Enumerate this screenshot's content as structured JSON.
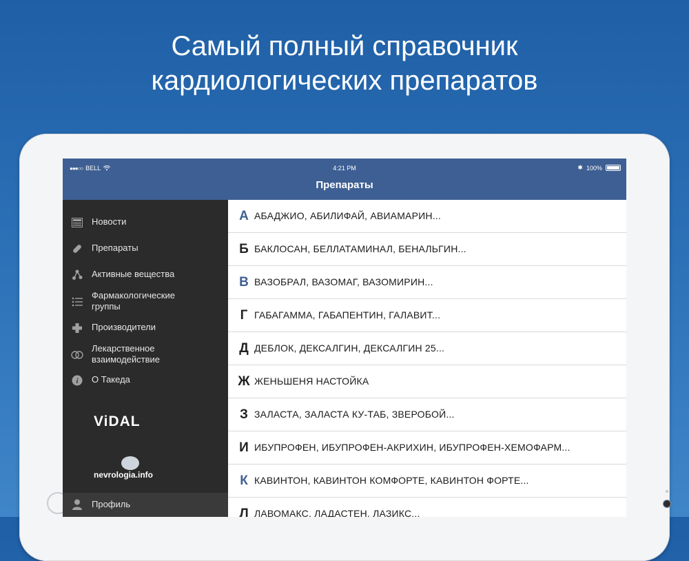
{
  "headline": {
    "line1": "Самый полный справочник",
    "line2": "кардиологических препаратов"
  },
  "status_bar": {
    "carrier": "BELL",
    "signal_dots": "●●●○○",
    "time": "4:21 PM",
    "battery": "100%"
  },
  "nav": {
    "title": "Препараты"
  },
  "sidebar": {
    "items": [
      {
        "label": "Новости",
        "icon": "news-icon"
      },
      {
        "label": "Препараты",
        "icon": "pill-icon"
      },
      {
        "label": "Активные вещества",
        "icon": "molecule-icon"
      },
      {
        "label": "Фармакологические группы",
        "icon": "list-icon"
      },
      {
        "label": "Производители",
        "icon": "plus-icon"
      },
      {
        "label": "Лекарственное взаимодействие",
        "icon": "interaction-icon"
      },
      {
        "label": "О Такеда",
        "icon": "info-icon"
      }
    ],
    "vidal_logo": "ViDAL",
    "nevrologia_logo": "nevrologia.info",
    "profile_label": "Профиль"
  },
  "alphabet_list": [
    {
      "letter": "А",
      "text": "АБАДЖИО, АБИЛИФАЙ, АВИАМАРИН..."
    },
    {
      "letter": "Б",
      "text": "БАКЛОСАН, БЕЛЛАТАМИНАЛ, БЕНАЛЬГИН..."
    },
    {
      "letter": "В",
      "text": "ВАЗОБРАЛ, ВАЗОМАГ, ВАЗОМИРИН..."
    },
    {
      "letter": "Г",
      "text": "ГАБАГАММА, ГАБАПЕНТИН, ГАЛАВИТ..."
    },
    {
      "letter": "Д",
      "text": "ДЕБЛОК, ДЕКСАЛГИН, ДЕКСАЛГИН 25..."
    },
    {
      "letter": "Ж",
      "text": "ЖЕНЬШЕНЯ НАСТОЙКА"
    },
    {
      "letter": "З",
      "text": "ЗАЛАСТА, ЗАЛАСТА КУ-ТАБ, ЗВЕРОБОЙ..."
    },
    {
      "letter": "И",
      "text": "ИБУПРОФЕН, ИБУПРОФЕН-АКРИХИН, ИБУПРОФЕН-ХЕМОФАРМ..."
    },
    {
      "letter": "К",
      "text": "КАВИНТОН, КАВИНТОН КОМФОРТЕ, КАВИНТОН ФОРТЕ..."
    },
    {
      "letter": "Л",
      "text": "ЛАВОМАКС, ЛАДАСТЕН, ЛАЗИКС..."
    }
  ],
  "colors": {
    "background_top": "#1f5fa6",
    "nav_bar": "#3e5f93",
    "sidebar": "#2b2b2b",
    "accent_letter": "#3e5f93"
  }
}
